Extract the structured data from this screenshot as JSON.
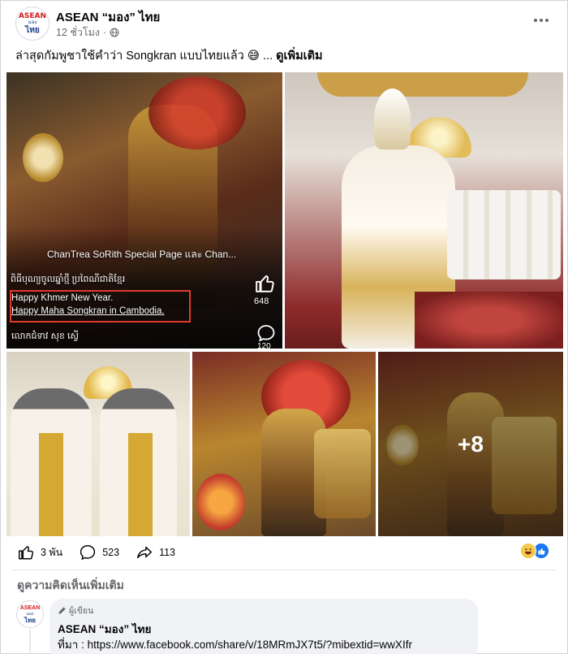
{
  "post": {
    "page_name": "ASEAN “มอง” ไทย",
    "time": "12 ชั่วโมง",
    "separator": "·",
    "more_icon": "more-horizontal-icon",
    "caption": "ล่าสุดกัมพูชาใช้คำว่า Songkran แบบไทยแล้ว",
    "caption_emoji": "😅",
    "ellipsis": "...",
    "see_more": "ดูเพิ่มเติม",
    "avatar": {
      "line1": "ASEAN",
      "line2": "มอง",
      "line3": "ไทย"
    }
  },
  "photos": {
    "main_overlay": {
      "source_label": "ChanTrea SoRith Special Page และ Chan...",
      "khmer_line": "ពិធីបុណ្យចូលឆ្នាំថ្មី ប្រពៃណីជាតិខ្មែរ",
      "line1": "Happy Khmer New Year.",
      "line2": "Happy Maha Songkran in Cambodia.",
      "credit": "លោកជំទាវ សុខ ស្វើ",
      "like_count": "648",
      "comment_count": "120"
    },
    "more_count": "+8"
  },
  "actions": {
    "likes": "3 พัน",
    "comments": "523",
    "shares": "113"
  },
  "comments_section": {
    "view_more": "ดูความคิดเห็นเพิ่มเติม",
    "comment": {
      "badge": "ผู้เขียน",
      "author": "ASEAN “มอง” ไทย",
      "text_prefix": "ที่มา :",
      "link": "https://www.facebook.com/share/v/18MRmJX7t5/?mibextid=wwXIfr"
    }
  },
  "colors": {
    "highlight_box": "#e23a2b",
    "like_blue": "#1877f2",
    "haha_yellow": "#f7c94a",
    "secondary_text": "#65676b"
  }
}
